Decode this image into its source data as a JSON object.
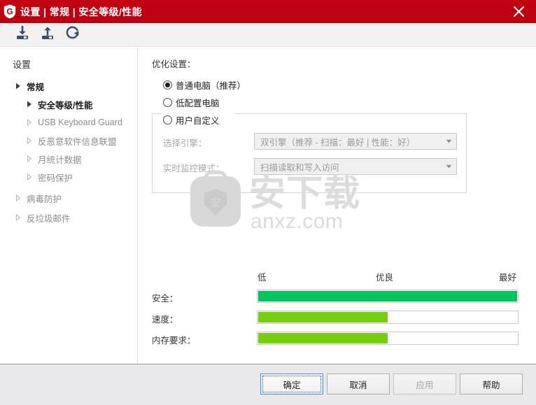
{
  "window": {
    "title": "设置 | 常规 | 安全等级/性能",
    "close_label": "×",
    "logo_letter": "G"
  },
  "toolbar": {
    "buttons": [
      {
        "name": "import-settings",
        "icon": "download-icon"
      },
      {
        "name": "export-settings",
        "icon": "upload-icon"
      },
      {
        "name": "reset-settings",
        "icon": "refresh-icon"
      }
    ]
  },
  "sidebar": {
    "title": "设置",
    "items": [
      {
        "label": "常规",
        "level": 1,
        "state": "active"
      },
      {
        "label": "安全等级/性能",
        "level": 2,
        "state": "active"
      },
      {
        "label": "USB Keyboard Guard",
        "level": 2,
        "state": "dim"
      },
      {
        "label": "反恶意软件信息联盟",
        "level": 2,
        "state": "dim"
      },
      {
        "label": "月统计数据",
        "level": 2,
        "state": "dim"
      },
      {
        "label": "密码保护",
        "level": 2,
        "state": "dim"
      },
      {
        "label": "病毒防护",
        "level": 1,
        "state": "dim"
      },
      {
        "label": "反垃圾邮件",
        "level": 1,
        "state": "dim"
      }
    ]
  },
  "main": {
    "section_title": "优化设置：",
    "radios": [
      {
        "label": "普通电脑（推荐）",
        "checked": true
      },
      {
        "label": "低配置电脑",
        "checked": false
      },
      {
        "label": "用户自定义",
        "checked": false
      }
    ],
    "fields": [
      {
        "label": "选择引擎：",
        "value": "双引擎（推荐 - 扫描：最好 | 性能：好）",
        "disabled": true
      },
      {
        "label": "实时监控模式：",
        "value": "扫描读取和写入访问",
        "disabled": true
      }
    ],
    "scale": {
      "low": "低",
      "mid": "优良",
      "high": "最好"
    },
    "meters": [
      {
        "label": "安全：",
        "percent": 100,
        "color": "#00c45e"
      },
      {
        "label": "速度：",
        "percent": 50,
        "color": "#76ce11"
      },
      {
        "label": "内存要求：",
        "percent": 50,
        "color": "#76ce11"
      }
    ]
  },
  "watermark": {
    "text_cn": "安下载",
    "text_url": "anxz.com",
    "logo_char": "安"
  },
  "footer": {
    "buttons": [
      {
        "label": "确定",
        "state": "primary"
      },
      {
        "label": "取消",
        "state": "normal"
      },
      {
        "label": "应用",
        "state": "disabled"
      },
      {
        "label": "帮助",
        "state": "normal"
      }
    ]
  },
  "colors": {
    "titlebar": "#be0011",
    "accent_green": "#00c45e",
    "accent_lime": "#76ce11",
    "toolbar_icon": "#3b5068"
  }
}
